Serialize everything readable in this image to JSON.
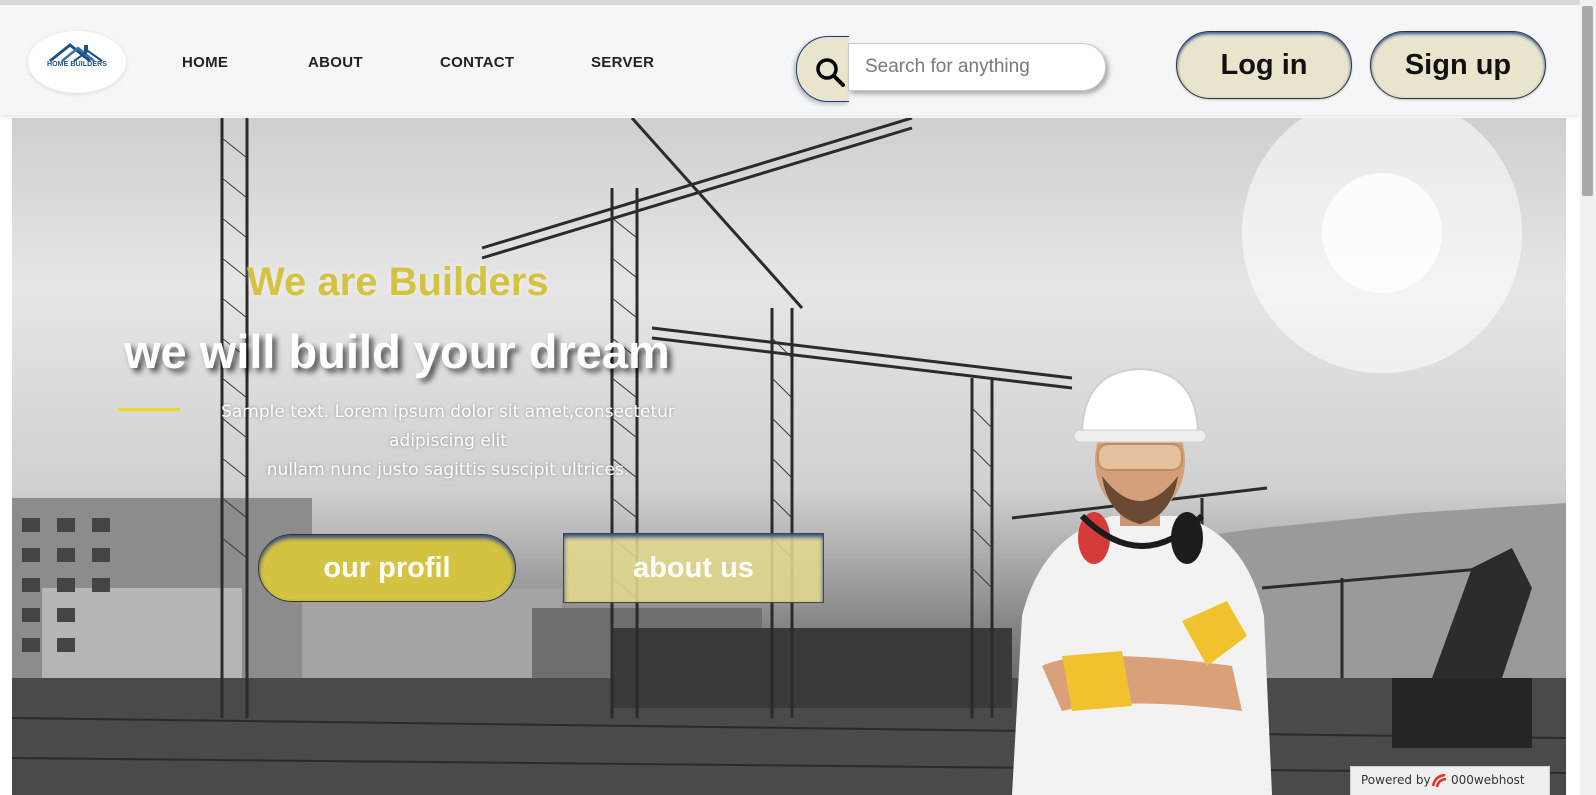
{
  "brand": {
    "logo_text": "HOME BUILDERS"
  },
  "nav": {
    "items": [
      {
        "label": "HOME"
      },
      {
        "label": "ABOUT"
      },
      {
        "label": "CONTACT"
      },
      {
        "label": "SERVER"
      }
    ]
  },
  "search": {
    "placeholder": "Search for anything",
    "icon": "search-icon"
  },
  "auth": {
    "login_label": "Log in",
    "signup_label": "Sign up"
  },
  "hero": {
    "subtitle": "We are Builders",
    "title": "we will build your dream",
    "text_line1": "Sample text. Lorem ipsum dolor sit amet,consectetur",
    "text_line2": "adipiscing elit",
    "text_line3": "nullam nunc justo sagittis suscipit ultrices.",
    "profile_button": "our profil",
    "about_button": "about us"
  },
  "footer_badge": {
    "powered_label": "Powered by",
    "host_label": "000webhost"
  },
  "colors": {
    "accent_yellow": "#d4c341",
    "button_cream": "#e8e5cc",
    "button_inner_shadow": "#2e4f9a",
    "nav_bg": "#f5f6f8",
    "logo_blue": "#1f4f86"
  }
}
